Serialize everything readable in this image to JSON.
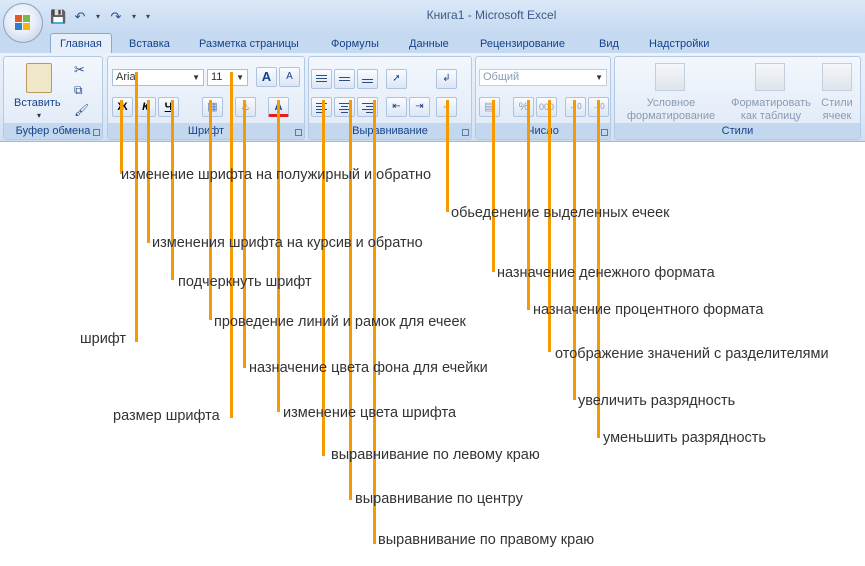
{
  "window": {
    "title": "Книга1 - Microsoft Excel"
  },
  "tabs": [
    "Главная",
    "Вставка",
    "Разметка страницы",
    "Формулы",
    "Данные",
    "Рецензирование",
    "Вид",
    "Надстройки"
  ],
  "groups": {
    "clipboard": {
      "label": "Буфер обмена",
      "paste": "Вставить"
    },
    "font": {
      "label": "Шрифт",
      "font_name": "Arial",
      "font_size": "11",
      "bold": "Ж",
      "italic": "К",
      "underline": "Ч",
      "grow": "A",
      "shrink": "A",
      "color": "A"
    },
    "alignment": {
      "label": "Выравнивание"
    },
    "number": {
      "label": "Число",
      "format": "Общий",
      "percent": "%",
      "thousands": "000"
    },
    "styles": {
      "label": "Стили",
      "conditional": "Условное форматирование",
      "as_table": "Форматировать как таблицу",
      "cell_styles": "Стили ячеек"
    }
  },
  "annotations": {
    "bold": "изменение шрифта на полужирный и обратно",
    "merge": "обьеденение выделенных ечеек",
    "italic": "изменения шрифта на курсив и обратно",
    "currency": "назначение денежного формата",
    "underline": "подчеркнуть шрифт",
    "percent": "назначение процентного формата",
    "borders": "проведение линий и рамок для ечеек",
    "font": "шрифт",
    "thousands": "отображение значений с разделителями",
    "fill": "назначение цвета фона для ечейки",
    "increase_decimal": "увеличить разрядность",
    "font_size": "размер шрифта",
    "font_color": "изменение цвета шрифта",
    "decrease_decimal": "уменьшить разрядность",
    "align_left": "выравнивание по левому краю",
    "align_center": "выравнивание по центру",
    "align_right": "выравнивание по правому краю"
  },
  "colors": {
    "accent": "#f59b00",
    "ribbon": "#dde8f6",
    "tab_text": "#15428b"
  }
}
